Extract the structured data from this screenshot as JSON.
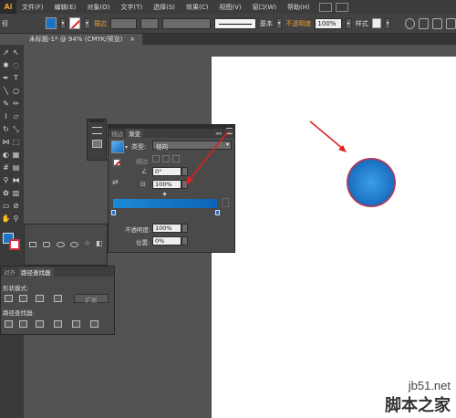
{
  "menubar": {
    "logo": "Ai",
    "items": [
      "文件(F)",
      "编辑(E)",
      "对象(O)",
      "文字(T)",
      "选择(S)",
      "效果(C)",
      "视图(V)",
      "窗口(W)",
      "帮助(H)"
    ]
  },
  "controlbar": {
    "left_label": "径",
    "stroke_label": "描边",
    "stroke_style": "基本",
    "opacity_label": "不透明度",
    "opacity_value": "100%",
    "style_label": "样式"
  },
  "document": {
    "tab_title": "未标题-1* @ 94% (CMYK/预览)",
    "close": "×"
  },
  "gradient_panel": {
    "tabs": [
      "描边",
      "渐变"
    ],
    "type_label": "类型:",
    "type_value": "径向",
    "stroke_label": "描边",
    "angle_value": "0°",
    "aspect_value": "100%",
    "opacity_label": "不透明度:",
    "opacity_value": "100%",
    "location_label": "位置:",
    "location_value": "0%",
    "collapse": "◂◂",
    "close": "×"
  },
  "pathfinder_panel": {
    "tabs": [
      "对齐",
      "路径查找器"
    ],
    "shape_modes_label": "形状模式:",
    "pathfinders_label": "路径查找器:",
    "expand_label": "扩展"
  },
  "watermark": {
    "domain": "jb51.net",
    "name": "脚本之家"
  },
  "colors": {
    "accent": "#f0a030",
    "gradient_start": "#1c8ad6",
    "gradient_end": "#0e62b8",
    "circle_stroke": "#d42c3c",
    "arrow": "#e02020"
  },
  "icons": [
    "ai-logo-icon",
    "selection-tool-icon",
    "pen-tool-icon",
    "type-tool-icon",
    "ellipse-tool-icon",
    "brush-tool-icon",
    "pencil-tool-icon",
    "trash-icon",
    "panel-menu-icon"
  ]
}
